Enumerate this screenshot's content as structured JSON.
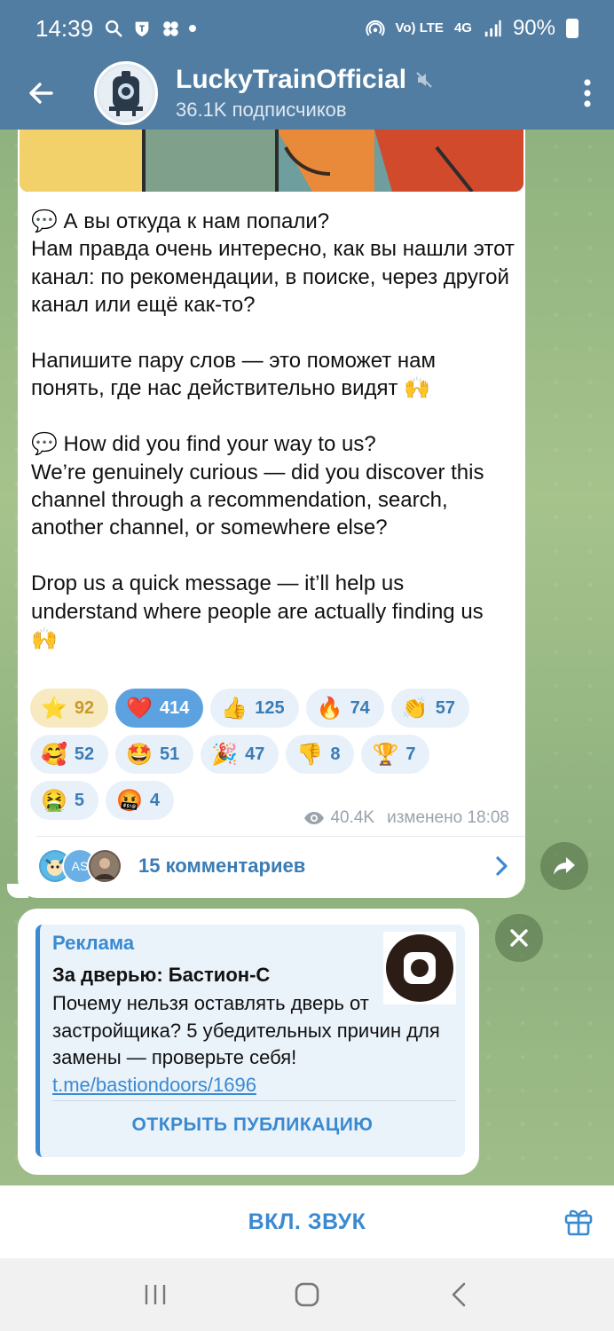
{
  "status_bar": {
    "time": "14:39",
    "network": "Vo) LTE",
    "network_gen": "4G",
    "battery": "90%"
  },
  "header": {
    "title": "LuckyTrainOfficial",
    "subtitle": "36.1K подписчиков",
    "muted": true
  },
  "message": {
    "text": "💬 А вы откуда к нам попали?\nНам правда очень интересно, как вы нашли этот канал: по рекомендации, в поиске, через другой канал или ещё как-то?\n\nНапишите пару слов — это поможет нам понять, где нас действительно видят 🙌\n\n💬 How did you find your way to us?\nWe’re genuinely curious — did you discover this channel through a recommendation, search, another channel, or somewhere else?\n\nDrop us a quick message — it’ll help us understand where people are actually finding us 🙌",
    "reactions": [
      {
        "emoji": "⭐",
        "count": "92",
        "icon": "star-icon"
      },
      {
        "emoji": "❤️",
        "count": "414",
        "icon": "heart-icon"
      },
      {
        "emoji": "👍",
        "count": "125",
        "icon": "thumbs-up-icon"
      },
      {
        "emoji": "🔥",
        "count": "74",
        "icon": "fire-icon"
      },
      {
        "emoji": "👏",
        "count": "57",
        "icon": "clap-icon"
      },
      {
        "emoji": "🥰",
        "count": "52",
        "icon": "smiling-hearts-icon"
      },
      {
        "emoji": "🤩",
        "count": "51",
        "icon": "star-struck-icon"
      },
      {
        "emoji": "🎉",
        "count": "47",
        "icon": "party-popper-icon"
      },
      {
        "emoji": "👎",
        "count": "8",
        "icon": "thumbs-down-icon"
      },
      {
        "emoji": "🏆",
        "count": "7",
        "icon": "trophy-icon"
      },
      {
        "emoji": "🤮",
        "count": "5",
        "icon": "vomiting-icon"
      },
      {
        "emoji": "🤬",
        "count": "4",
        "icon": "cursing-icon"
      }
    ],
    "views": "40.4K",
    "edited_time": "изменено 18:08",
    "comments_label": "15 комментариев",
    "comment_avatars": [
      "AS"
    ]
  },
  "ad": {
    "label": "Реклама",
    "title": "За дверью: Бастион-С",
    "body": "Почему нельзя оставлять дверь от застройщика? 5 убедительных причин для замены — проверьте себя! ",
    "link": "t.me/bastiondoors/1696",
    "action": "ОТКРЫТЬ ПУБЛИКАЦИЮ"
  },
  "bottom_bar": {
    "unmute_label": "ВКЛ. ЗВУК"
  },
  "colors": {
    "header_bg": "#517da2",
    "accent": "#3a8ad1",
    "active_reaction": "#5ca2e0"
  }
}
